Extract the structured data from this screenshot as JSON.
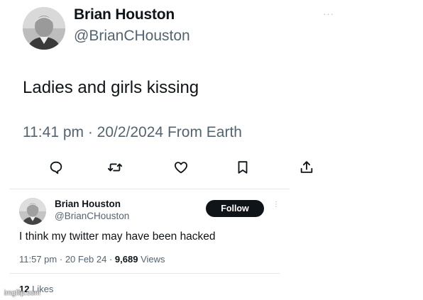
{
  "tweet": {
    "author_name": "Brian Houston",
    "author_handle": "@BrianCHouston",
    "more_label": "···",
    "text": "Ladies and girls kissing",
    "time": "11:41 pm",
    "separator": " · ",
    "date": "20/2/2024",
    "source": " From Earth",
    "actions": [
      {
        "name": "reply",
        "icon": "reply-icon"
      },
      {
        "name": "retweet",
        "icon": "retweet-icon"
      },
      {
        "name": "like",
        "icon": "heart-icon"
      },
      {
        "name": "bookmark",
        "icon": "bookmark-icon"
      },
      {
        "name": "share",
        "icon": "share-icon"
      }
    ]
  },
  "reply_tweet": {
    "author_name": "Brian Houston",
    "author_handle": "@BrianCHouston",
    "follow_label": "Follow",
    "more_label": "⋮",
    "text": "I think my twitter may have been hacked",
    "time": "11:57 pm",
    "separator": " · ",
    "date": "20 Feb 24",
    "views_count": "9,689",
    "views_label": " Views",
    "likes_count": "12",
    "likes_label": " Likes"
  },
  "watermark": "imgflip.com",
  "colors": {
    "text": "#0f1419",
    "secondary_text": "#536471",
    "follow_button_bg": "#0f1419"
  }
}
